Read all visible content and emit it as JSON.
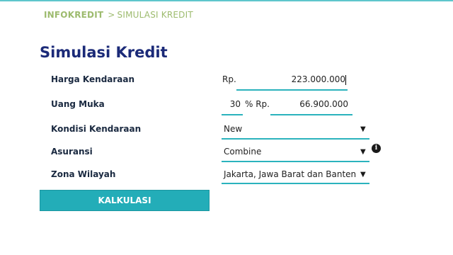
{
  "breadcrumb": {
    "home": "INFOKREDIT",
    "separator": ">",
    "current": "SIMULASI KREDIT"
  },
  "page_title": "Simulasi Kredit",
  "form": {
    "harga": {
      "label": "Harga Kendaraan",
      "currency": "Rp.",
      "value": "223.000.000"
    },
    "uang_muka": {
      "label": "Uang Muka",
      "percent_value": "30",
      "percent_suffix": "% Rp.",
      "amount_value": "66.900.000"
    },
    "kondisi": {
      "label": "Kondisi Kendaraan",
      "selected": "New"
    },
    "asuransi": {
      "label": "Asuransi",
      "selected": "Combine"
    },
    "zona": {
      "label": "Zona Wilayah",
      "selected": "Jakarta, Jawa Barat dan Banten"
    }
  },
  "actions": {
    "calculate_label": "KALKULASI"
  },
  "icons": {
    "dropdown": "chevron-down-icon",
    "info": "info-icon"
  },
  "colors": {
    "accent": "#23adb8",
    "title": "#1b2a78",
    "breadcrumb": "#9dbb6e",
    "underline": "#2bb3bd"
  }
}
